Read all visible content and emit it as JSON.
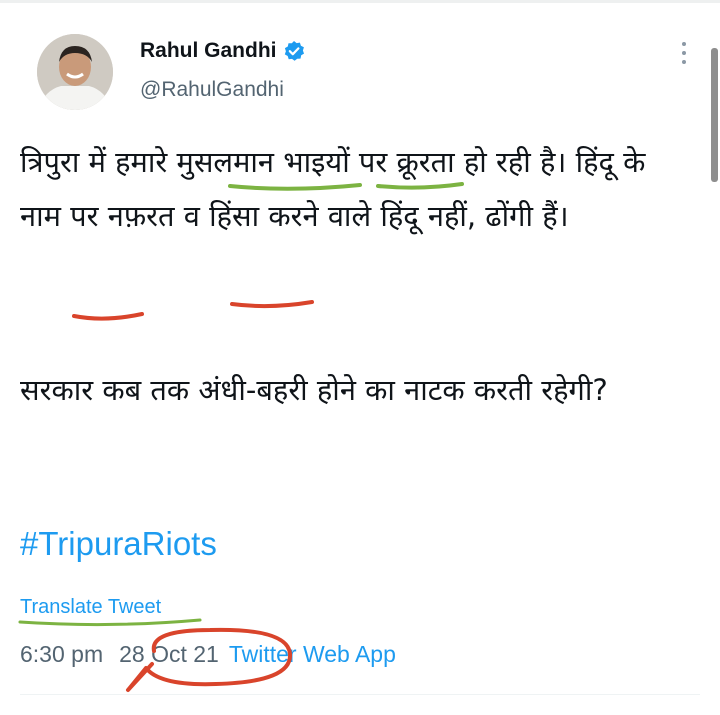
{
  "tweet": {
    "author": {
      "display_name": "Rahul Gandhi",
      "handle": "@RahulGandhi",
      "verified": true,
      "verified_icon": "verified-badge-icon"
    },
    "more_icon": "more-vertical-icon",
    "paragraphs": [
      "त्रिपुरा में हमारे मुसलमान भाइयों पर क्रूरता हो रही है। हिंदू के नाम पर नफ़रत व हिंसा करने वाले हिंदू नहीं, ढोंगी हैं।",
      "सरकार कब तक अंधी-बहरी होने का नाटक करती रहेगी?"
    ],
    "hashtag": "#TripuraRiots",
    "translate_label": "Translate Tweet",
    "time": "6:30 pm",
    "date": "28 Oct 21",
    "source": "Twitter Web App"
  },
  "colors": {
    "link": "#1d9bf0",
    "secondary_text": "#536471",
    "primary_text": "#0f1419",
    "annotation_green": "#7cb342",
    "annotation_red": "#d9442b"
  }
}
